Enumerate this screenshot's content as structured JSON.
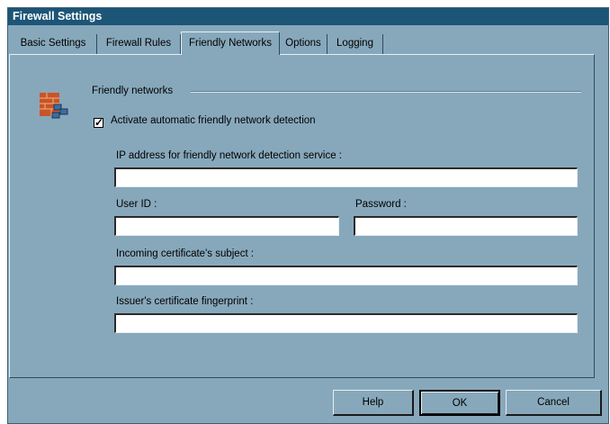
{
  "window": {
    "title": "Firewall Settings"
  },
  "tabs": [
    {
      "label": "Basic Settings",
      "active": false
    },
    {
      "label": "Firewall Rules",
      "active": false
    },
    {
      "label": "Friendly Networks",
      "active": true
    },
    {
      "label": "Options",
      "active": false
    },
    {
      "label": "Logging",
      "active": false
    }
  ],
  "group": {
    "title": "Friendly networks",
    "icon": "firewall-network-icon"
  },
  "auto_detect": {
    "label": "Activate automatic friendly network detection",
    "checked": true
  },
  "fields": {
    "ip_label": "IP address for friendly network detection service :",
    "ip_value": "",
    "userid_label": "User ID :",
    "userid_value": "",
    "password_label": "Password :",
    "password_value": "",
    "subject_label": "Incoming certificate's subject :",
    "subject_value": "",
    "fingerprint_label": "Issuer's certificate fingerprint :",
    "fingerprint_value": ""
  },
  "buttons": {
    "help": "Help",
    "ok": "OK",
    "cancel": "Cancel"
  },
  "colors": {
    "titlebar": "#1d5577",
    "face": "#87a8bb"
  }
}
